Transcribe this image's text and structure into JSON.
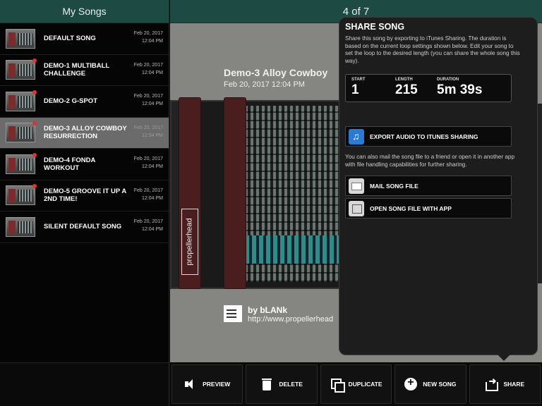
{
  "sidebar": {
    "title": "My Songs",
    "songs": [
      {
        "name": "DEFAULT SONG",
        "date": "Feb 20, 2017",
        "time": "12:04 PM",
        "selected": false
      },
      {
        "name": "DEMO-1 MULTIBALL CHALLENGE",
        "date": "Feb 20, 2017",
        "time": "12:04 PM",
        "selected": false
      },
      {
        "name": "DEMO-2 G-SPOT",
        "date": "Feb 20, 2017",
        "time": "12:04 PM",
        "selected": false
      },
      {
        "name": "DEMO-3 ALLOY COWBOY RESURRECTION",
        "date": "Feb 20, 2017",
        "time": "12:04 PM",
        "selected": true
      },
      {
        "name": "DEMO-4 FONDA WORKOUT",
        "date": "Feb 20, 2017",
        "time": "12:04 PM",
        "selected": false
      },
      {
        "name": "DEMO-5 GROOVE IT UP A 2ND TIME!",
        "date": "Feb 20, 2017",
        "time": "12:04 PM",
        "selected": false
      },
      {
        "name": "SILENT DEFAULT SONG",
        "date": "Feb 20, 2017",
        "time": "12:04 PM",
        "selected": false
      }
    ]
  },
  "main": {
    "counter": "4 of 7",
    "song_title": "Demo-3 Alloy Cowboy",
    "song_datetime": "Feb 20, 2017 12:04 PM",
    "brand": "propellerhead",
    "author": "by bLANk",
    "url": "http://www.propellerhead"
  },
  "share": {
    "title": "SHARE SONG",
    "description": "Share this song by exporting to iTunes Sharing. The duration is based on the current loop settings shown below. Edit your song to set the loop to the desired length (you can share the whole song this way).",
    "start_label": "START",
    "start_value": "1",
    "length_label": "LENGTH",
    "length_value": "215",
    "duration_label": "DURATION",
    "duration_value": "5m 39s",
    "export_label": "EXPORT AUDIO TO ITUNES SHARING",
    "note": "You can also mail the song file to a friend or open it in another app with file handling capabilities for further sharing.",
    "mail_label": "MAIL SONG FILE",
    "open_label": "OPEN SONG FILE WITH APP"
  },
  "toolbar": {
    "preview": "PREVIEW",
    "delete": "DELETE",
    "duplicate": "DUPLICATE",
    "new_song": "NEW SONG",
    "share": "SHARE"
  },
  "icons": [
    "speaker-icon",
    "trash-icon",
    "duplicate-icon",
    "plus-circle-icon",
    "share-icon",
    "itunes-icon",
    "mail-icon",
    "open-with-app-icon",
    "document-icon"
  ],
  "colors": {
    "header_bg": "#1d4a43",
    "selected_row": "#6b6b6b",
    "popover_bg": "#1d1d1d"
  }
}
